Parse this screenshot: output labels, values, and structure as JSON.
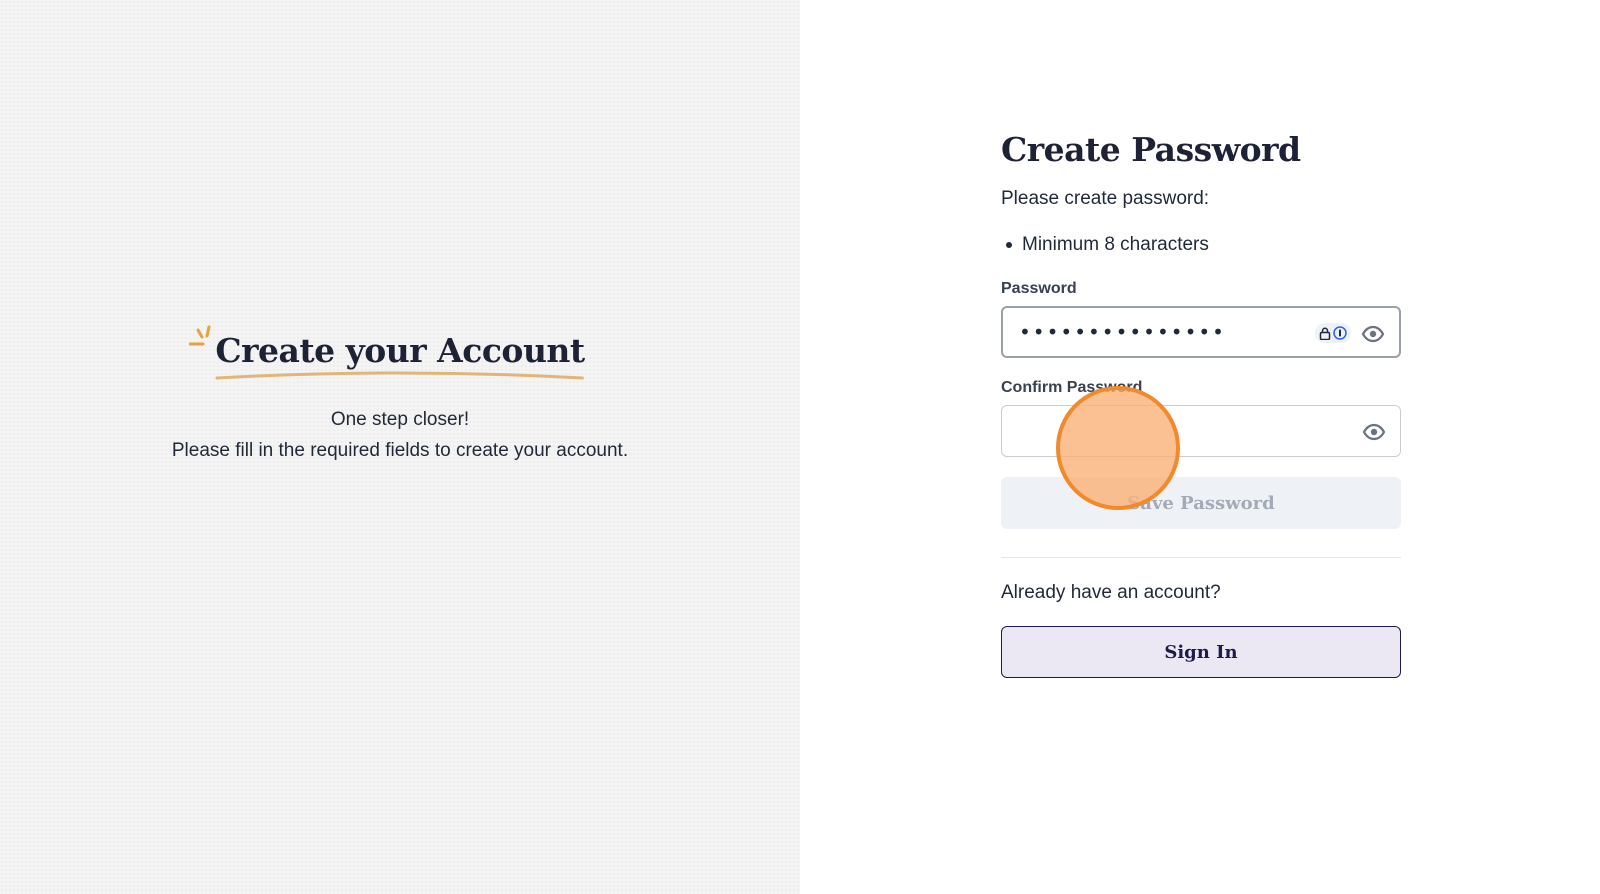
{
  "left": {
    "title": "Create your Account",
    "subtitle_line1": "One step closer!",
    "subtitle_line2": "Please fill in the required fields to create your account.",
    "accent_color": "#e8a23a"
  },
  "form": {
    "title": "Create Password",
    "instructions": "Please create password:",
    "requirements": [
      "Minimum 8 characters"
    ],
    "password": {
      "label": "Password",
      "value": "•••••••••••••••",
      "icons": [
        "password-manager-icon",
        "eye-icon"
      ]
    },
    "confirm_password": {
      "label": "Confirm Password",
      "value": "",
      "icons": [
        "eye-icon"
      ]
    },
    "save_label": "Save Password",
    "already_text": "Already have an account?",
    "signin_label": "Sign In"
  },
  "colors": {
    "heading": "#1e2235",
    "signin_border": "#1e1b4b",
    "signin_bg": "#ebe8f3",
    "save_bg_disabled": "#eef1f6",
    "click_indicator": "#f08a2c"
  }
}
